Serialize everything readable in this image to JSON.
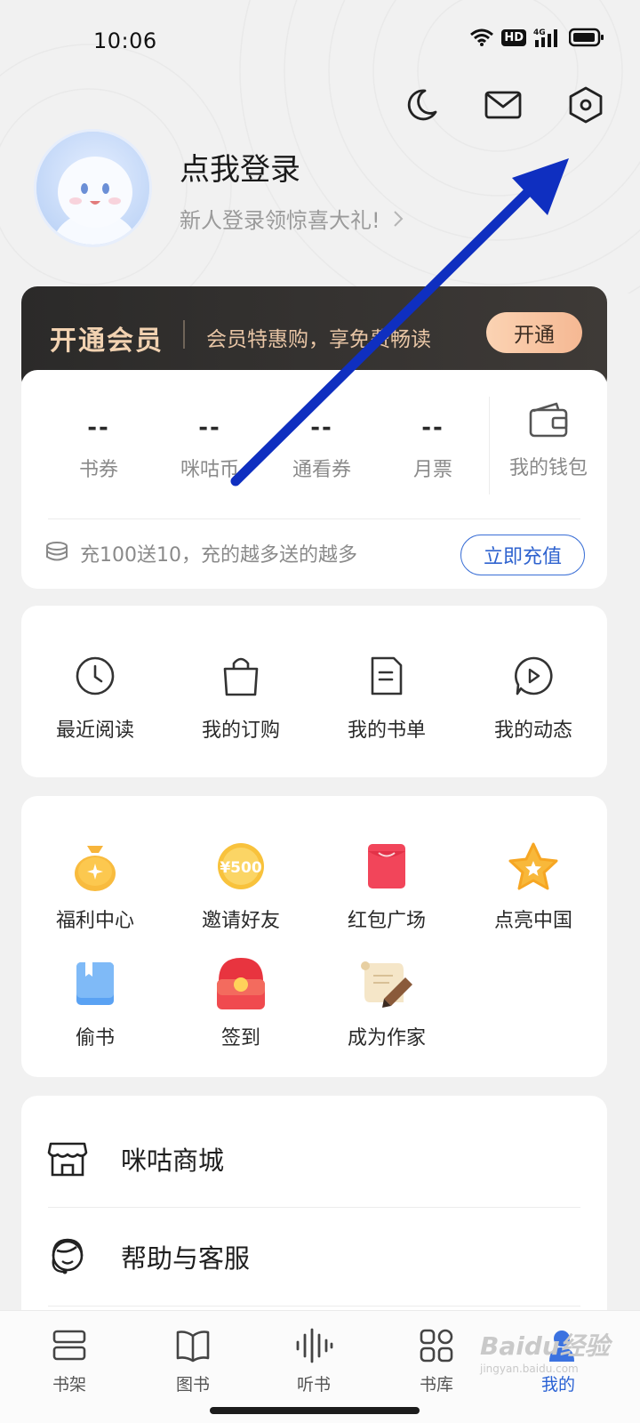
{
  "status_bar": {
    "time": "10:06",
    "hd": "HD",
    "network": "4G"
  },
  "header": {
    "icons": [
      "night-mode-icon",
      "message-icon",
      "settings-icon"
    ],
    "login_title": "点我登录",
    "login_subtitle": "新人登录领惊喜大礼!"
  },
  "vip": {
    "title": "开通会员",
    "description": "会员特惠购，享免费畅读",
    "button": "开通",
    "colors": {
      "background": "#2b2a29",
      "text": "#f2d2b1",
      "button": "#f9c9a6"
    }
  },
  "wallet": {
    "stats": [
      {
        "value": "--",
        "label": "书券"
      },
      {
        "value": "--",
        "label": "咪咕币"
      },
      {
        "value": "--",
        "label": "通看券"
      },
      {
        "value": "--",
        "label": "月票"
      }
    ],
    "wallet_label": "我的钱包",
    "recharge_text": "充100送10，充的越多送的越多",
    "recharge_button": "立即充值",
    "accent_color": "#2f63cf"
  },
  "quick_links": [
    {
      "label": "最近阅读",
      "icon": "clock-icon"
    },
    {
      "label": "我的订购",
      "icon": "bag-icon"
    },
    {
      "label": "我的书单",
      "icon": "booklist-icon"
    },
    {
      "label": "我的动态",
      "icon": "activity-icon"
    }
  ],
  "welfare": [
    {
      "label": "福利中心",
      "icon": "money-bag-icon"
    },
    {
      "label": "邀请好友",
      "icon": "coin-500-icon",
      "badge": "¥500"
    },
    {
      "label": "红包广场",
      "icon": "red-packet-icon"
    },
    {
      "label": "点亮中国",
      "icon": "star-icon"
    },
    {
      "label": "偷书",
      "icon": "book-icon"
    },
    {
      "label": "签到",
      "icon": "sign-in-icon"
    },
    {
      "label": "成为作家",
      "icon": "scroll-pen-icon"
    }
  ],
  "menu": [
    {
      "label": "咪咕商城",
      "icon": "shop-icon"
    },
    {
      "label": "帮助与客服",
      "icon": "customer-service-icon"
    }
  ],
  "tabbar": [
    {
      "label": "书架",
      "icon": "bookshelf-icon"
    },
    {
      "label": "图书",
      "icon": "open-book-icon"
    },
    {
      "label": "听书",
      "icon": "audio-wave-icon"
    },
    {
      "label": "书库",
      "icon": "library-grid-icon"
    },
    {
      "label": "我的",
      "icon": "profile-icon",
      "active": true
    }
  ],
  "watermark": {
    "brand": "Baidu经验",
    "url": "jingyan.baidu.com"
  },
  "annotation_color": "#0f2fc0"
}
